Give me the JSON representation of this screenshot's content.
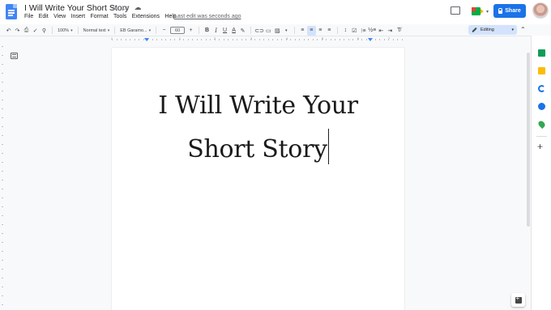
{
  "app": {
    "title": "I Will Write Your Short Story",
    "last_edit": "Last edit was seconds ago"
  },
  "menu": [
    "File",
    "Edit",
    "View",
    "Insert",
    "Format",
    "Tools",
    "Extensions",
    "Help"
  ],
  "header": {
    "share_label": "Share"
  },
  "toolbar": {
    "zoom": "100%",
    "style": "Normal text",
    "font": "EB Garamo...",
    "font_size": "60",
    "mode": "Editing"
  },
  "ruler": {
    "numbers": [
      "1",
      "1",
      "2",
      "3",
      "4",
      "5",
      "6",
      "7"
    ]
  },
  "document": {
    "lines": [
      "I Will Write Your",
      "Short Story"
    ]
  },
  "colors": {
    "accent": "#1a73e8",
    "mode_bg": "#d3e3fd"
  }
}
